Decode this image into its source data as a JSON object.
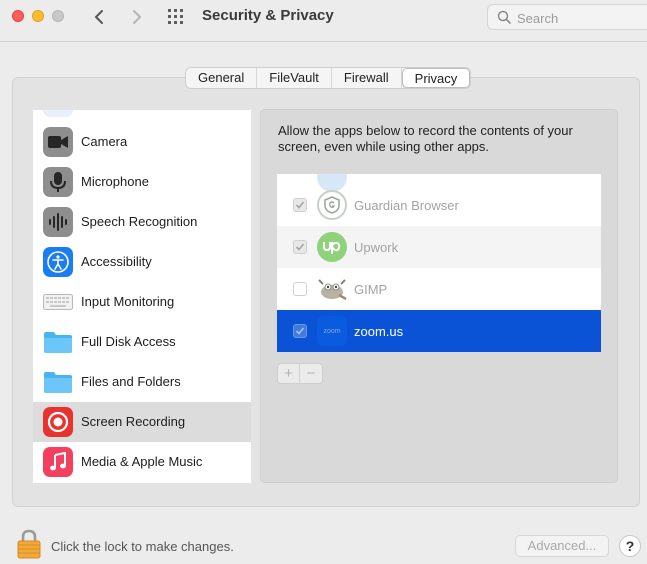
{
  "window": {
    "title": "Security & Privacy",
    "search_placeholder": "Search"
  },
  "tabs": [
    {
      "label": "General",
      "active": false
    },
    {
      "label": "FileVault",
      "active": false
    },
    {
      "label": "Firewall",
      "active": false
    },
    {
      "label": "Privacy",
      "active": true
    }
  ],
  "sidebar": {
    "selected": "Screen Recording",
    "items": [
      {
        "label": "Camera",
        "icon": "camera-icon"
      },
      {
        "label": "Microphone",
        "icon": "microphone-icon"
      },
      {
        "label": "Speech Recognition",
        "icon": "waveform-icon"
      },
      {
        "label": "Accessibility",
        "icon": "accessibility-icon"
      },
      {
        "label": "Input Monitoring",
        "icon": "keyboard-icon"
      },
      {
        "label": "Full Disk Access",
        "icon": "folder-icon"
      },
      {
        "label": "Files and Folders",
        "icon": "folder-icon"
      },
      {
        "label": "Screen Recording",
        "icon": "screen-recording-icon"
      },
      {
        "label": "Media & Apple Music",
        "icon": "music-note-icon"
      }
    ]
  },
  "content": {
    "description": "Allow the apps below to record the contents of your screen, even while using other apps.",
    "apps": [
      {
        "name": "Guardian Browser",
        "checked": true,
        "icon": "guardian-shield-icon"
      },
      {
        "name": "Upwork",
        "checked": true,
        "icon": "upwork-icon"
      },
      {
        "name": "GIMP",
        "checked": false,
        "icon": "gimp-icon"
      },
      {
        "name": "zoom.us",
        "checked": true,
        "icon": "zoom-icon",
        "icon_text": "zoom",
        "selected": true
      }
    ],
    "add_label": "+",
    "remove_label": "−"
  },
  "footer": {
    "lock_text": "Click the lock to make changes.",
    "advanced_label": "Advanced...",
    "help_label": "?"
  },
  "colors": {
    "selection_blue": "#0a52d6",
    "close": "#fe5f57",
    "minimize": "#febc2e"
  }
}
